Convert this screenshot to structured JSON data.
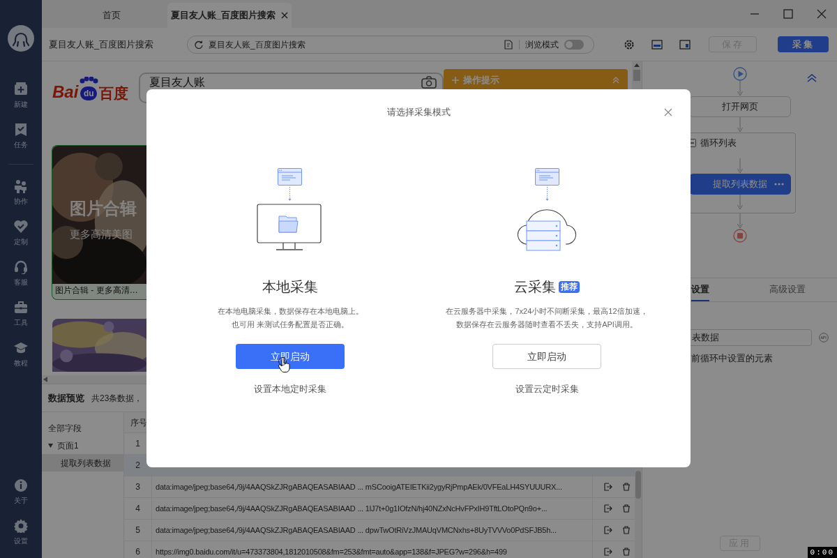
{
  "tabs": [
    {
      "label": "首页",
      "selected": false
    },
    {
      "label": "夏目友人账_百度图片搜索",
      "selected": true
    }
  ],
  "toolbar": {
    "page_title": "夏目友人账_百度图片搜索",
    "address": "夏目友人账_百度图片搜索",
    "browse_mode": {
      "label": "浏览模式",
      "on": false
    },
    "save_button": {
      "label": "保存",
      "disabled": true
    },
    "collect_button": {
      "label": "采集",
      "disabled": false
    }
  },
  "sidebar": {
    "items": [
      {
        "label": "新建"
      },
      {
        "label": "任务"
      },
      {
        "label": "协作"
      },
      {
        "label": "定制"
      },
      {
        "label": "客服"
      },
      {
        "label": "工具"
      },
      {
        "label": "教程"
      }
    ],
    "bottom_items": [
      {
        "label": "关于"
      },
      {
        "label": "设置"
      }
    ]
  },
  "browser": {
    "logo": {
      "latin": "Bai",
      "paw": "du",
      "chinese": "百度"
    },
    "search_query": "夏目友人账",
    "tips_panel": {
      "label": "操作提示"
    },
    "cards": [
      {
        "overlay_title": "图片合辑",
        "overlay_subtitle": "更多高清美图",
        "caption": "图片合辑 - 更多高清…",
        "selected": true
      },
      {
        "selected": false
      }
    ]
  },
  "data_preview": {
    "title": "数据预览",
    "count": "共23条数据，",
    "all_fields": "全部字段",
    "pages": [
      {
        "label": "页面1",
        "expanded": true,
        "children": [
          {
            "label": "提取列表数据",
            "selected": true
          }
        ]
      }
    ],
    "table": {
      "columns": [
        "序号"
      ],
      "rows": [
        {
          "index": "1",
          "selected": false
        },
        {
          "index": "2",
          "selected": true
        },
        {
          "index": "3",
          "selected": false,
          "value": "data:image/jpeg;base64,/9j/4AAQSkZJRgABAQEASABIAAD ... mSCooigATEIETKii2ygyRjPmpAEk/0VFEaLH4SYUUURX..."
        },
        {
          "index": "4",
          "selected": false,
          "value": "data:image/jpeg;base64,/9j/4AAQSkZJRgABAQEASABIAAD ... 1lJ7t+0g1IOfzN/hj40NZxNcHvFPxIH9TftLOtoPQn9o+..."
        },
        {
          "index": "5",
          "selected": false,
          "value": "data:image/jpeg;base64,/9j/4AAQSkZJRgABAQEASABIAAD ... dpwTwOtRiVzJMAUqVMCNxhs+8UyTVVVo0PdSFJB5h..."
        },
        {
          "index": "6",
          "selected": false,
          "value": "https://img0.baidu.com/it/u=473373804,1812010508&fm=253&fmt=auto&app=138&f=JPEG?w=296&h=499"
        }
      ]
    }
  },
  "workflow": {
    "steps": [
      {
        "kind": "start"
      },
      {
        "kind": "action",
        "label": "打开网页",
        "selected": false
      },
      {
        "kind": "loop",
        "label": "循环列表",
        "expanded": true,
        "children": [
          {
            "kind": "action",
            "label": "提取列表数据",
            "selected": true
          }
        ]
      },
      {
        "kind": "end"
      }
    ]
  },
  "settings": {
    "tabs": [
      {
        "label": "设置",
        "selected": true
      },
      {
        "label": "高级设置",
        "selected": false
      }
    ],
    "name_value": "表数据",
    "note": "前循环中设置的元素",
    "apply_button": {
      "label": "应用",
      "disabled": true
    }
  },
  "modal": {
    "title": "请选择采集模式",
    "options": [
      {
        "kind": "local",
        "title": "本地采集",
        "description": [
          "在本地电脑采集，数据保存在本地电脑上。",
          "也可用 来测试任务配置是否正确。"
        ],
        "button": {
          "label": "立即启动",
          "primary": true
        },
        "schedule_link": "设置本地定时采集"
      },
      {
        "kind": "cloud",
        "title": "云采集",
        "badge": "推荐",
        "description": [
          "在云服务器中采集，7x24小时不间断采集，最高12倍加速，",
          "数据保存在云服务器随时查看不丢失，支持API调用。"
        ],
        "button": {
          "label": "立即启动",
          "primary": false
        },
        "schedule_link": "设置云定时采集"
      }
    ]
  },
  "recorder_timer": "0:00"
}
